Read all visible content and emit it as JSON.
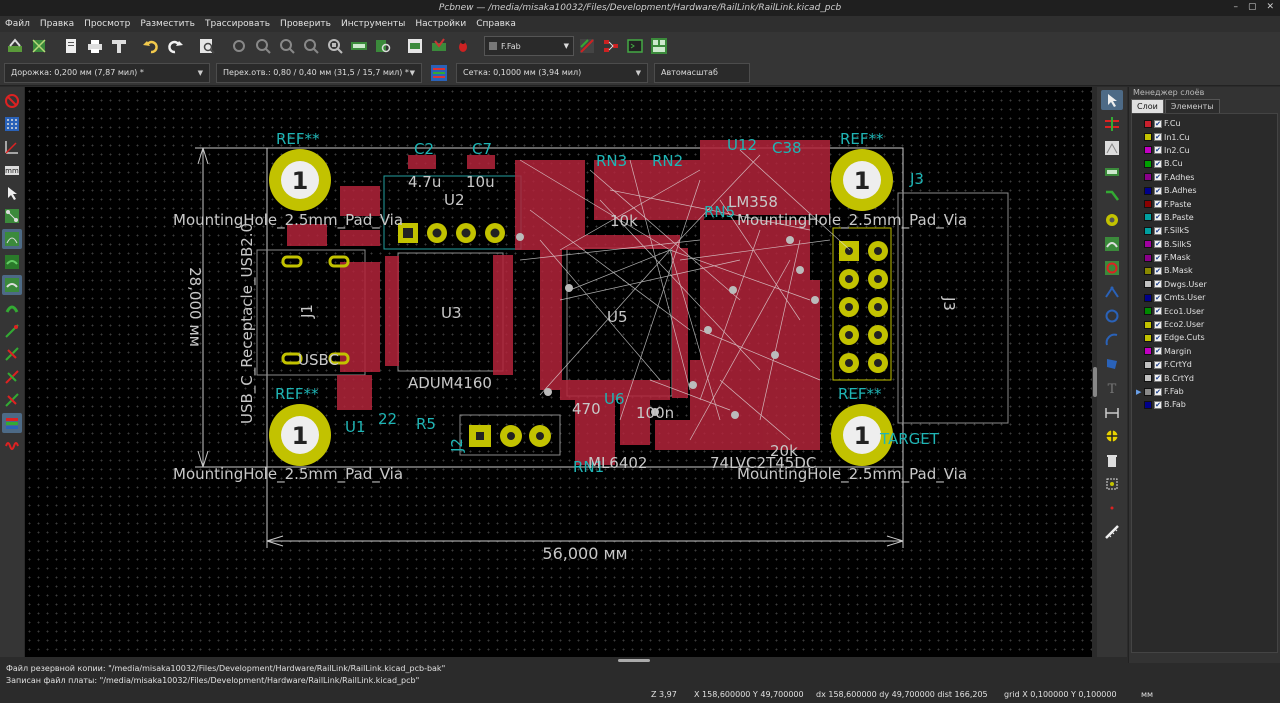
{
  "window": {
    "title": "Pcbnew — /media/misaka10032/Files/Development/Hardware/RailLink/RailLink.kicad_pcb",
    "buttons": [
      "–",
      "▢",
      "✕"
    ]
  },
  "menu": [
    "Файл",
    "Правка",
    "Просмотр",
    "Разместить",
    "Трассировать",
    "Проверить",
    "Инструменты",
    "Настройки",
    "Справка"
  ],
  "toolbar": {
    "active_layer": "F.Fab",
    "icons": [
      "board-setup-icon",
      "footprint-editor-icon",
      "page-settings-icon",
      "print-icon",
      "plot-icon",
      "undo-icon",
      "redo-icon",
      "find-icon",
      "refresh-icon",
      "zoom-in-icon",
      "zoom-out-icon",
      "zoom-fit-icon",
      "zoom-selection-icon",
      "netlist-icon",
      "footprint-browser-icon",
      "read-netlist-icon",
      "drc-icon",
      "bug-icon",
      "layer-pair-icon",
      "pad-icon",
      "script-console-icon",
      "microwave-icon"
    ]
  },
  "options": {
    "track": "Дорожка: 0,200 мм (7,87 мил) *",
    "via": "Перех.отв.: 0,80 / 0,40 мм (31,5 / 15,7 мил) *",
    "grid": "Сетка: 0,1000 мм (3,94 мил)",
    "zoom": "Автомасштаб"
  },
  "pcb": {
    "labels": {
      "ref_tl": "REF**",
      "ref_tr": "REF**",
      "ref_bl": "REF**",
      "ref_br": "REF**",
      "mh_top_left": "MountingHole_2.5mm_Pad_Via",
      "mh_top_right": "MountingHole_2.5mm_Pad_Via",
      "mh_bottom_left": "MountingHole_2.5mm_Pad_Via",
      "mh_bottom_right": "MountingHole_2.5mm_Pad_Via",
      "hole_num": "1",
      "dim_h": "56,000 мм",
      "dim_v": "28,000 мм",
      "usb_fp": "USB_C_Receptacle_USB2.0",
      "c2": "C2",
      "c2v": "4.7u",
      "c7": "C7",
      "c7v": "10u",
      "u2": "U2",
      "u3": "U3",
      "adum": "ADUM4160",
      "u5": "U5",
      "u1": "U1",
      "u12": "U12",
      "c38": "C38",
      "lm": "LM358",
      "rn3": "RN3",
      "rn2": "RN2",
      "rn5": "RN5",
      "j1": "J1",
      "j2": "J2",
      "j3": "J3",
      "j3b": "J3",
      "r5": "R5",
      "r1": "R1",
      "v22": "22",
      "usbc": "USBC",
      "target": "TARGET",
      "rn1": "RN1",
      "ml": "ML6402",
      "lvc": "74LVC2T45DC",
      "v470": "470",
      "v100n": "100n",
      "v10k": "10k",
      "v20k": "20k"
    }
  },
  "layers": {
    "header": "Менеджер слоёв",
    "tabs": [
      "Слои",
      "Элементы"
    ],
    "items": [
      {
        "name": "F.Cu",
        "color": "#c8202d",
        "current": false
      },
      {
        "name": "In1.Cu",
        "color": "#c2c200",
        "current": false
      },
      {
        "name": "In2.Cu",
        "color": "#c200c2",
        "current": false
      },
      {
        "name": "B.Cu",
        "color": "#00a000",
        "current": false
      },
      {
        "name": "F.Adhes",
        "color": "#8a008a",
        "current": false
      },
      {
        "name": "B.Adhes",
        "color": "#00008a",
        "current": false
      },
      {
        "name": "F.Paste",
        "color": "#8a0000",
        "current": false
      },
      {
        "name": "B.Paste",
        "color": "#00a0a0",
        "current": false
      },
      {
        "name": "F.SilkS",
        "color": "#00a0a0",
        "current": false
      },
      {
        "name": "B.SilkS",
        "color": "#a000a0",
        "current": false
      },
      {
        "name": "F.Mask",
        "color": "#8a008a",
        "current": false
      },
      {
        "name": "B.Mask",
        "color": "#8a8a00",
        "current": false
      },
      {
        "name": "Dwgs.User",
        "color": "#c2c2c2",
        "current": false
      },
      {
        "name": "Cmts.User",
        "color": "#00008a",
        "current": false
      },
      {
        "name": "Eco1.User",
        "color": "#008a00",
        "current": false
      },
      {
        "name": "Eco2.User",
        "color": "#c2c200",
        "current": false
      },
      {
        "name": "Edge.Cuts",
        "color": "#c2c200",
        "current": false
      },
      {
        "name": "Margin",
        "color": "#c200c2",
        "current": false
      },
      {
        "name": "F.CrtYd",
        "color": "#c2c2c2",
        "current": false
      },
      {
        "name": "B.CrtYd",
        "color": "#c2c2c2",
        "current": false
      },
      {
        "name": "F.Fab",
        "color": "#8a8a8a",
        "current": true
      },
      {
        "name": "B.Fab",
        "color": "#00008a",
        "current": false
      }
    ]
  },
  "messages": [
    "Файл резервной копии: \"/media/misaka10032/Files/Development/Hardware/RailLink/RailLink.kicad_pcb-bak\"",
    "Записан файл платы: \"/media/misaka10032/Files/Development/Hardware/RailLink/RailLink.kicad_pcb\""
  ],
  "status": {
    "zoom": "Z 3,97",
    "xy": "X 158,600000  Y 49,700000",
    "delta": "dx 158,600000  dy 49,700000  dist 166,205",
    "grid": "grid X 0,100000  Y 0,100000",
    "units": "мм"
  }
}
